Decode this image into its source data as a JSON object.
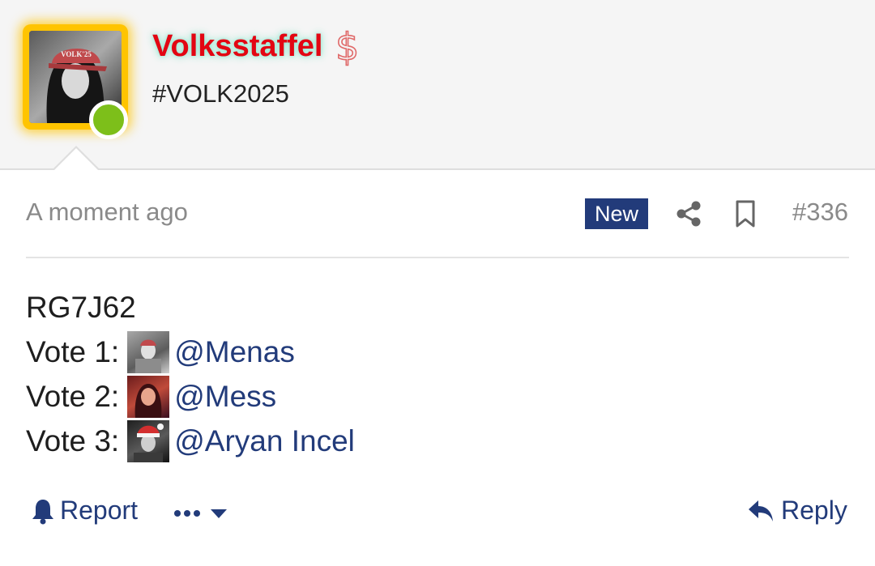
{
  "post": {
    "author": {
      "username": "Volksstaffel",
      "user_title": "#VOLK2025",
      "avatar_cap_text": "VOLK'25",
      "online": true,
      "donor_icon": "dollar-sign-icon"
    },
    "meta": {
      "timestamp": "A moment ago",
      "badge": "New",
      "post_number": "#336"
    },
    "body": {
      "code": "RG7J62",
      "votes": [
        {
          "label": "Vote 1:",
          "mention": "@Menas"
        },
        {
          "label": "Vote 2:",
          "mention": "@Mess"
        },
        {
          "label": "Vote 3:",
          "mention": "@Aryan Incel"
        }
      ]
    },
    "actions": {
      "report": "Report",
      "reply": "Reply"
    }
  },
  "colors": {
    "accent": "#223b7a",
    "username": "#e30613",
    "online": "#7dbf1a",
    "avatar_frame": "#ffc400",
    "muted_text": "#8a8a8a"
  }
}
